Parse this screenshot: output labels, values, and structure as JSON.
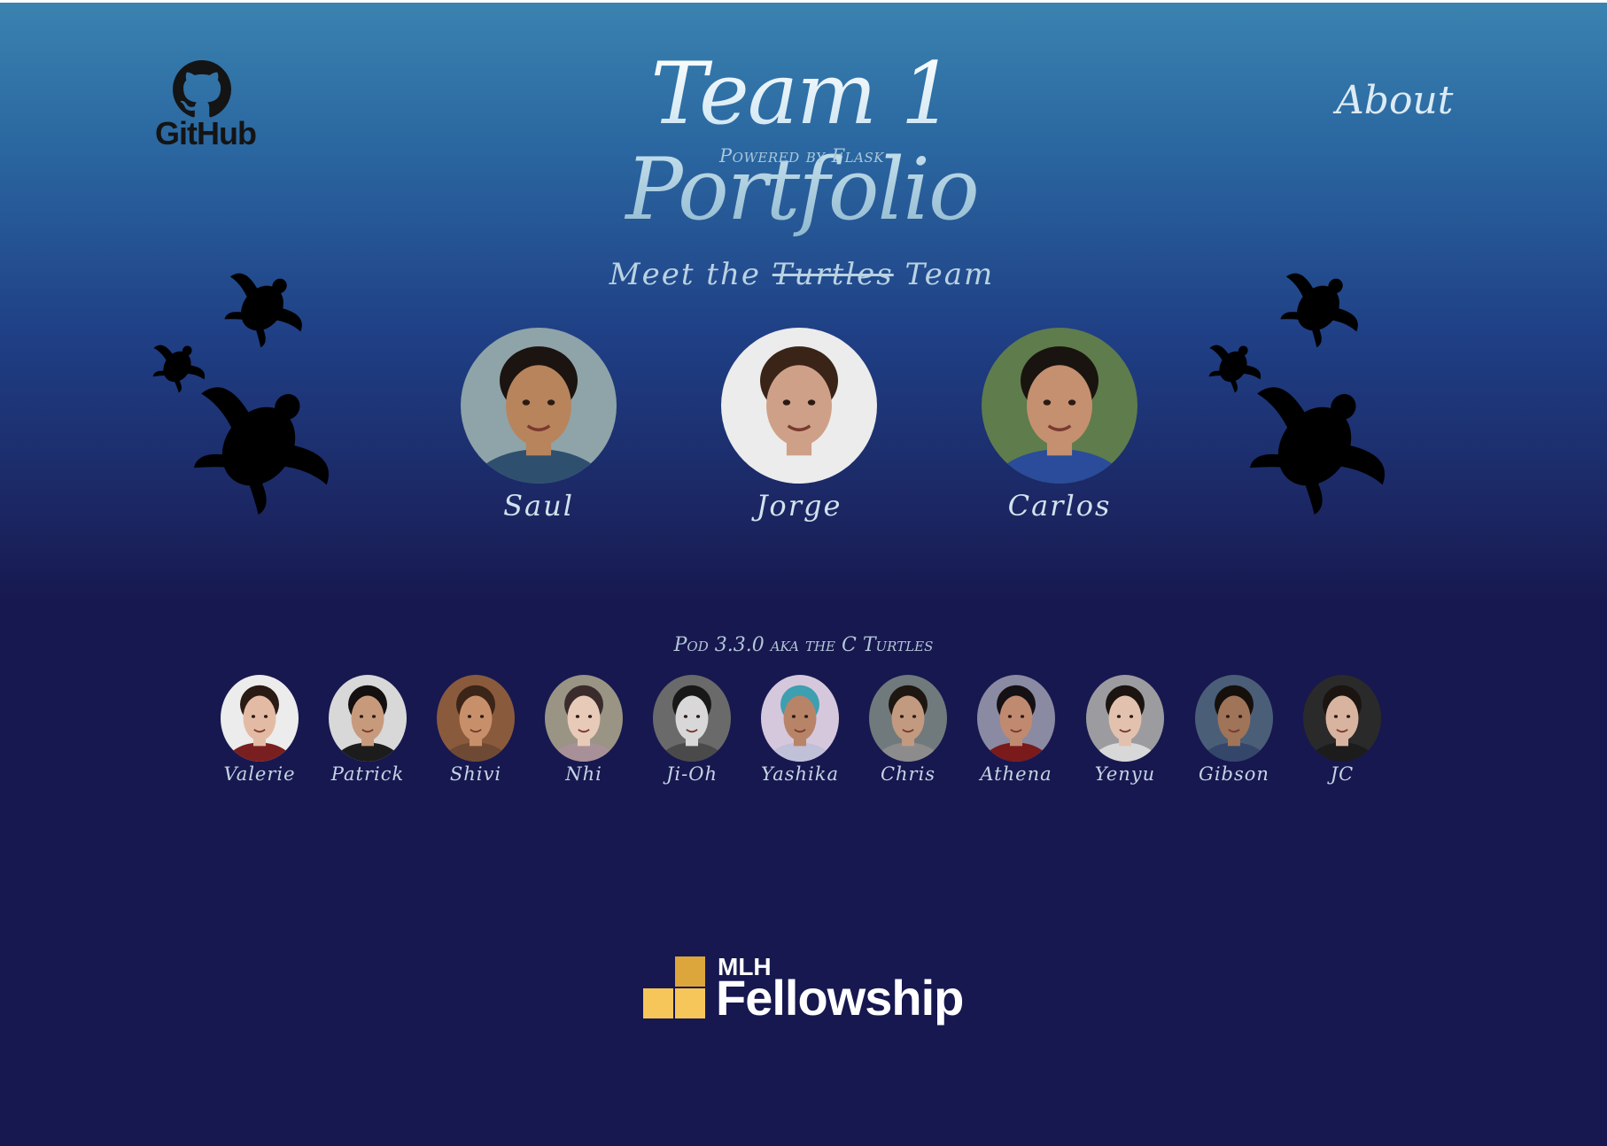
{
  "header": {
    "github_label": "GitHub",
    "title": "Team 1 Portfolio",
    "subtitle": "Powered by Flask",
    "about_label": "About"
  },
  "team": {
    "heading_prefix": "Meet the",
    "heading_struck": "Turtles",
    "heading_suffix": "Team",
    "members": [
      {
        "name": "Saul",
        "skin": "#b8845c",
        "hair": "#1c1410",
        "shirt": "#2f4f6e",
        "bg": "#8fa4a8"
      },
      {
        "name": "Jorge",
        "skin": "#cfa088",
        "hair": "#3a2418",
        "shirt": "#ececec",
        "bg": "#ececec"
      },
      {
        "name": "Carlos",
        "skin": "#c49070",
        "hair": "#1a1410",
        "shirt": "#2a4c9a",
        "bg": "#5f7c4c"
      }
    ]
  },
  "pod": {
    "heading": "Pod 3.3.0 aka the C Turtles",
    "members": [
      {
        "name": "Valerie",
        "skin": "#e3bba4",
        "hair": "#2a1a14",
        "shirt": "#7a1f1f",
        "bg": "#ececec"
      },
      {
        "name": "Patrick",
        "skin": "#c89a7c",
        "hair": "#141010",
        "shirt": "#1c1c1c",
        "bg": "#d8d8d8"
      },
      {
        "name": "Shivi",
        "skin": "#c8906a",
        "hair": "#3b2418",
        "shirt": "#6e4a34",
        "bg": "#8a5a3c"
      },
      {
        "name": "Nhi",
        "skin": "#e8cab8",
        "hair": "#3a2c2c",
        "shirt": "#a89098",
        "bg": "#9a9484"
      },
      {
        "name": "Ji-Oh",
        "skin": "#d8d8d8",
        "hair": "#181818",
        "shirt": "#4a4a4a",
        "bg": "#6a6a6a"
      },
      {
        "name": "Yashika",
        "skin": "#b88468",
        "hair": "#3d9fb0",
        "shirt": "#c0c0d8",
        "bg": "#d6c8dc"
      },
      {
        "name": "Chris",
        "skin": "#c29a80",
        "hair": "#1e1610",
        "shirt": "#8c8c8c",
        "bg": "#707a7c"
      },
      {
        "name": "Athena",
        "skin": "#c08a70",
        "hair": "#141014",
        "shirt": "#7a1a1a",
        "bg": "#8a8aa2"
      },
      {
        "name": "Yenyu",
        "skin": "#e2c2ae",
        "hair": "#1c1410",
        "shirt": "#d8d8d8",
        "bg": "#9c9ca0"
      },
      {
        "name": "Gibson",
        "skin": "#a07458",
        "hair": "#16100c",
        "shirt": "#34466a",
        "bg": "#4a5e78"
      },
      {
        "name": "JC",
        "skin": "#d8b4a0",
        "hair": "#1c1410",
        "shirt": "#1c1c1c",
        "bg": "#2a2a2a"
      }
    ]
  },
  "footer": {
    "mlh_small": "MLH",
    "mlh_big": "Fellowship",
    "colors": {
      "gold_dark": "#dca63c",
      "gold_light": "#f7c65a"
    }
  },
  "colors": {
    "turtle": "#000000",
    "title_text": "#d8ecf6"
  }
}
